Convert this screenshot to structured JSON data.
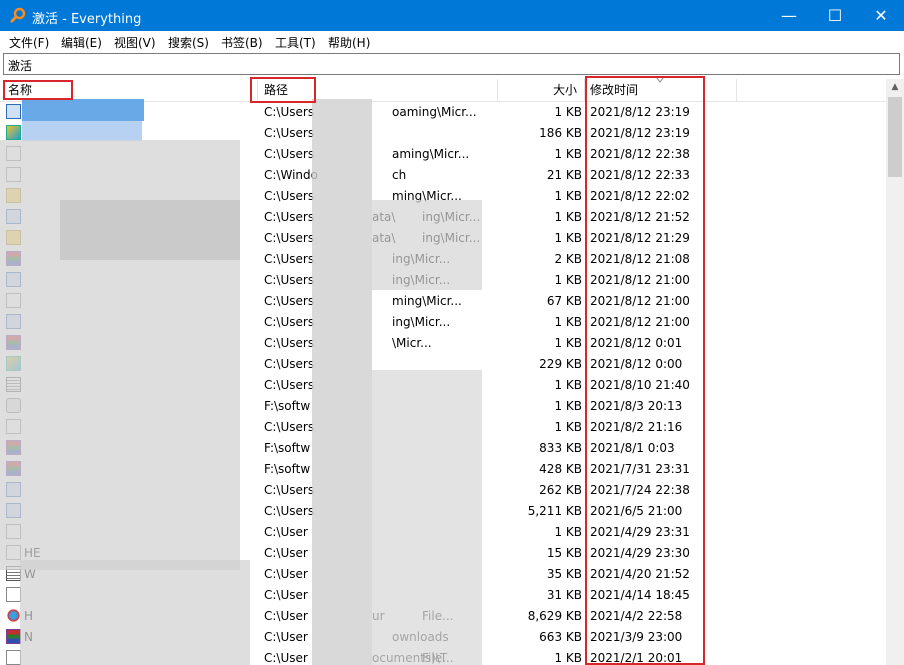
{
  "window": {
    "title": "激活 - Everything",
    "controls": {
      "minimize": "—",
      "maximize": "☐",
      "close": "✕"
    }
  },
  "menu": [
    "文件(F)",
    "编辑(E)",
    "视图(V)",
    "搜索(S)",
    "书签(B)",
    "工具(T)",
    "帮助(H)"
  ],
  "search": {
    "value": "激活"
  },
  "columns": {
    "name": "名称",
    "path": "路径",
    "size": "大小",
    "modified": "修改时间"
  },
  "rows": [
    {
      "icon": "blue-file-icon",
      "name": "",
      "path": "C:\\Users",
      "path_tail": "oaming\\Micr...",
      "size": "1 KB",
      "modified": "2021/8/12 23:19"
    },
    {
      "icon": "image-file-icon",
      "name": "",
      "path": "C:\\Users",
      "path_tail": "",
      "size": "186 KB",
      "modified": "2021/8/12 23:19"
    },
    {
      "icon": "document-icon",
      "name": "",
      "path": "C:\\Users",
      "path_tail": "aming\\Micr...",
      "size": "1 KB",
      "modified": "2021/8/12 22:38"
    },
    {
      "icon": "document-icon",
      "name": "",
      "path": "C:\\Windo",
      "path_tail": "ch",
      "size": "21 KB",
      "modified": "2021/8/12 22:33"
    },
    {
      "icon": "yellow-file-icon",
      "name": "",
      "path": "C:\\Users",
      "path_tail": "ming\\Micr...",
      "size": "1 KB",
      "modified": "2021/8/12 22:02"
    },
    {
      "icon": "blue-file-icon",
      "name": "",
      "path": "C:\\Users",
      "path_tail": "ata\\",
      "path_tail2": "ing\\Micr...",
      "size": "1 KB",
      "modified": "2021/8/12 21:52"
    },
    {
      "icon": "yellow-file-icon",
      "name": "",
      "path": "C:\\Users",
      "path_tail": "ata\\",
      "path_tail2": "ing\\Micr...",
      "size": "1 KB",
      "modified": "2021/8/12 21:29"
    },
    {
      "icon": "rar-archive-icon",
      "name": "",
      "path": "C:\\Users",
      "path_tail": "ing\\Micr...",
      "size": "2 KB",
      "modified": "2021/8/12 21:08"
    },
    {
      "icon": "blue-file-icon",
      "name": "",
      "path": "C:\\Users",
      "path_tail": "ing\\Micr...",
      "size": "1 KB",
      "modified": "2021/8/12 21:00"
    },
    {
      "icon": "document-icon",
      "name": "",
      "path": "C:\\Users",
      "path_tail": "ming\\Micr...",
      "size": "67 KB",
      "modified": "2021/8/12 21:00"
    },
    {
      "icon": "blue-file-icon",
      "name": "",
      "path": "C:\\Users",
      "path_tail": "ing\\Micr...",
      "size": "1 KB",
      "modified": "2021/8/12 21:00"
    },
    {
      "icon": "rar-archive-icon",
      "name": "",
      "path": "C:\\Users",
      "path_tail": "\\Micr...",
      "size": "1 KB",
      "modified": "2021/8/12 0:01"
    },
    {
      "icon": "image-file-icon",
      "name": "",
      "path": "C:\\Users",
      "path_tail": "",
      "size": "229 KB",
      "modified": "2021/8/12 0:00"
    },
    {
      "icon": "text-file-icon",
      "name": "",
      "path": "C:\\Users",
      "path_tail": "",
      "size": "1 KB",
      "modified": "2021/8/10 21:40"
    },
    {
      "icon": "gear-file-icon",
      "name": "",
      "path": "F:\\softw",
      "path_tail": "",
      "size": "1 KB",
      "modified": "2021/8/3 20:13"
    },
    {
      "icon": "document-icon",
      "name": "",
      "path": "C:\\Users",
      "path_tail": "",
      "size": "1 KB",
      "modified": "2021/8/2 21:16"
    },
    {
      "icon": "rar-archive-icon",
      "name": "",
      "path": "F:\\softw",
      "path_tail": "",
      "size": "833 KB",
      "modified": "2021/8/1 0:03"
    },
    {
      "icon": "rar-archive-icon",
      "name": "",
      "path": "F:\\softw",
      "path_tail": "",
      "size": "428 KB",
      "modified": "2021/7/31 23:31"
    },
    {
      "icon": "blue-file-icon",
      "name": "",
      "path": "C:\\Users",
      "path_tail": "",
      "size": "262 KB",
      "modified": "2021/7/24 22:38"
    },
    {
      "icon": "blue-file-icon",
      "name": "",
      "path": "C:\\Users",
      "path_tail": "",
      "size": "5,211 KB",
      "modified": "2021/6/5 21:00"
    },
    {
      "icon": "document-icon",
      "name": "",
      "path": "C:\\User",
      "path_tail": "",
      "size": "1 KB",
      "modified": "2021/4/29 23:31"
    },
    {
      "icon": "document-icon",
      "name": "HE",
      "path": "C:\\User",
      "path_tail": "",
      "size": "15 KB",
      "modified": "2021/4/29 23:30"
    },
    {
      "icon": "text-file-icon",
      "name": "W",
      "path": "C:\\User",
      "path_tail": "",
      "size": "35 KB",
      "modified": "2021/4/20 21:52"
    },
    {
      "icon": "document-icon",
      "name": "",
      "path": "C:\\User",
      "path_tail": "",
      "size": "31 KB",
      "modified": "2021/4/14 18:45"
    },
    {
      "icon": "star-app-icon",
      "name": "H",
      "path": "C:\\User",
      "path_tail": "ur",
      "path_tail2": "File...",
      "size": "8,629 KB",
      "modified": "2021/4/2 22:58"
    },
    {
      "icon": "rar-archive-icon",
      "name": "N",
      "path": "C:\\User",
      "path_tail": "ownloads",
      "size": "663 KB",
      "modified": "2021/3/9 23:00"
    },
    {
      "icon": "document-icon",
      "name": "",
      "path": "C:\\User",
      "path_tail": "ocuments)\\T",
      "path_tail2": "File...",
      "size": "1 KB",
      "modified": "2021/2/1 20:01"
    }
  ]
}
